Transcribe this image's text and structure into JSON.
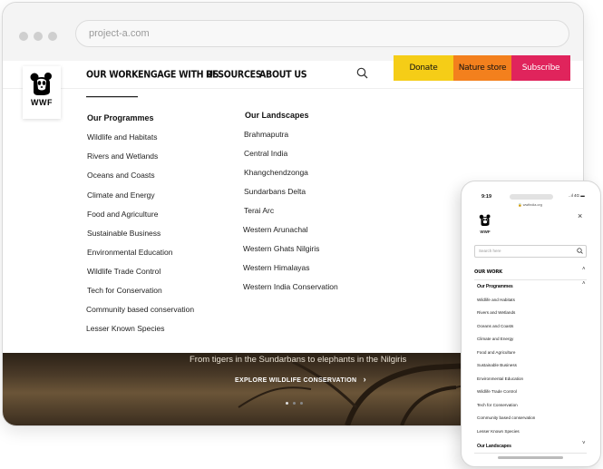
{
  "browser": {
    "url": "project-a.com"
  },
  "brand": {
    "logo_text": "WWF"
  },
  "nav": {
    "links": [
      "OUR WORK",
      "ENGAGE WITH US",
      "RESOURCES",
      "ABOUT US"
    ],
    "buttons": [
      {
        "label": "Donate",
        "color": "#f5cd17"
      },
      {
        "label": "Nature store",
        "color": "#f3801d"
      },
      {
        "label": "Subscribe",
        "color": "#e0245c"
      }
    ]
  },
  "menu": {
    "programmes_title": "Our Programmes",
    "programmes": [
      "Wildlife and Habitats",
      "Rivers and Wetlands",
      "Oceans and Coasts",
      "Climate and Energy",
      "Food and Agriculture",
      "Sustainable Business",
      "Environmental Education",
      "Wildlife Trade Control",
      "Tech for Conservation",
      "Community based conservation",
      "Lesser Known Species"
    ],
    "landscapes_title": "Our Landscapes",
    "landscapes": [
      "Brahmaputra",
      "Central India",
      "Khangchendzonga",
      "Sundarbans Delta",
      "Terai Arc",
      "Western Arunachal",
      "Western Ghats Nilgiris",
      "Western Himalayas",
      "Western India Conservation"
    ]
  },
  "hero": {
    "subtitle": "From tigers in the Sundarbans to elephants in the Nilgiris",
    "cta": "EXPLORE WILDLIFE CONSERVATION"
  },
  "phone": {
    "time": "9:19",
    "status": "..ıl 4G ▬",
    "url": "🔒 wwfindia.org",
    "search_placeholder": "Search here",
    "section": "OUR WORK",
    "programmes_title": "Our Programmes",
    "programmes": [
      "Wildlife and Habitats",
      "Rivers and Wetlands",
      "Oceans and Coasts",
      "Climate and Energy",
      "Food and Agriculture",
      "Sustainable Business",
      "Environmental Education",
      "Wildlife Trade Control",
      "Tech for Conservation",
      "Community based conservation",
      "Lesser Known Species"
    ],
    "landscapes_title": "Our Landscapes"
  }
}
